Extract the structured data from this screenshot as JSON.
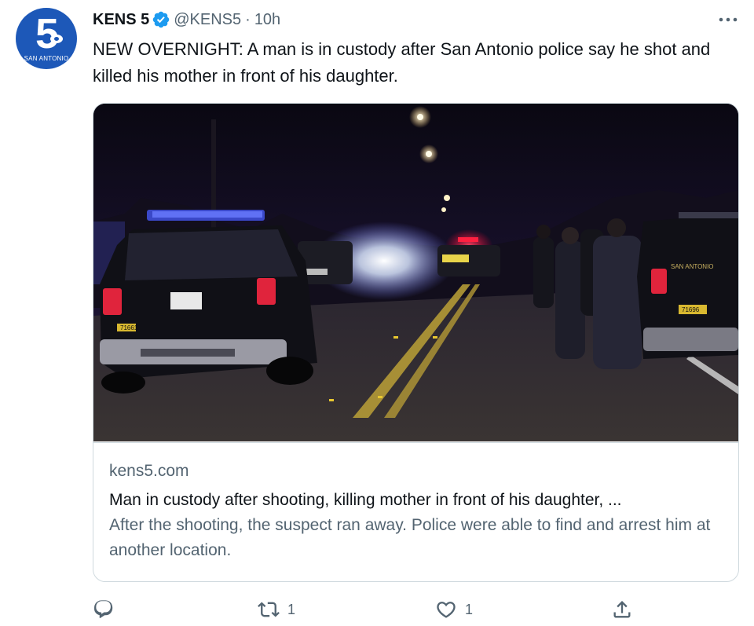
{
  "account": {
    "name": "KENS 5",
    "handle": "@KENS5",
    "separator": "·",
    "time": "10h",
    "avatar_text": "5",
    "avatar_city": "SAN ANTONIO",
    "verified_icon": "verified-badge-icon"
  },
  "tweet": {
    "text": "NEW OVERNIGHT: A man is in custody after San Antonio police say he shot and killed his mother in front of his daughter."
  },
  "card": {
    "domain": "kens5.com",
    "title": "Man in custody after shooting, killing mother in front of his daughter, ...",
    "description": "After the shooting, the suspect ran away. Police were able to find and arrest him at another location.",
    "image_alt": "police vehicles on a dark street at night",
    "plate_text": "71661",
    "plate_text_right": "71696",
    "door_text": "SAN ANTONIO"
  },
  "actions": {
    "reply": {
      "icon": "reply-icon",
      "count": ""
    },
    "retweet": {
      "icon": "retweet-icon",
      "count": "1"
    },
    "like": {
      "icon": "heart-icon",
      "count": "1"
    },
    "share": {
      "icon": "share-icon",
      "count": ""
    }
  },
  "colors": {
    "text": "#0f1419",
    "secondary": "#536471",
    "border": "#cfd9de",
    "verified": "#1d9bf0",
    "avatar": "#1d58b8"
  }
}
